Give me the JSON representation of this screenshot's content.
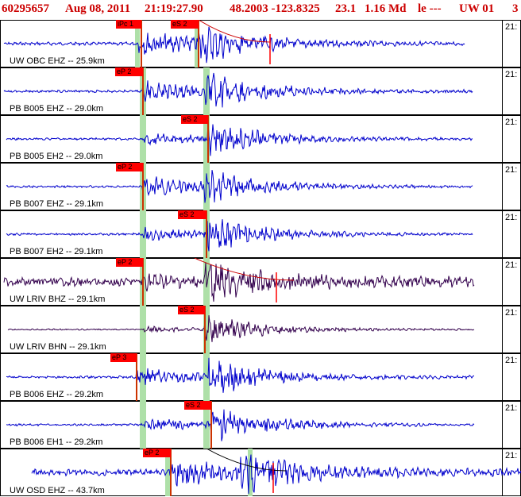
{
  "header": {
    "event_id": "60295657",
    "date": "Aug 08, 2011",
    "time": "21:19:27.90",
    "location": "48.2003 -123.8325",
    "depth": "23.1",
    "magnitude": "1.16 Md",
    "type": "le ---",
    "network": "UW 01",
    "extra": "3"
  },
  "colors": {
    "header_text": "#cc0000",
    "trace_blue": "#0000cc",
    "trace_dark": "#33004d",
    "pick_red": "#ff0000",
    "window_green": "#aee0a8",
    "coda_red": "#cc0000",
    "coda_black": "#000000"
  },
  "panels": [
    {
      "label": "UW OBC EHZ -- 25.9km",
      "time_label": "21:",
      "picks": [
        {
          "text": "iPc 1"
        },
        {
          "text": "eS 2"
        }
      ],
      "color": "blue",
      "coda": "red"
    },
    {
      "label": "PB B005 EHZ -- 29.0km",
      "time_label": "21:",
      "picks": [
        {
          "text": "eP 2"
        }
      ],
      "color": "blue",
      "coda": ""
    },
    {
      "label": "PB B005 EH2 -- 29.0km",
      "time_label": "21:",
      "picks": [
        {
          "text": "eS 2"
        }
      ],
      "color": "blue",
      "coda": ""
    },
    {
      "label": "PB B007 EHZ -- 29.1km",
      "time_label": "21:",
      "picks": [
        {
          "text": "eP 2"
        }
      ],
      "color": "blue",
      "coda": ""
    },
    {
      "label": "PB B007 EH2 -- 29.1km",
      "time_label": "21:",
      "picks": [
        {
          "text": "eS 2"
        }
      ],
      "color": "blue",
      "coda": ""
    },
    {
      "label": "UW LRIV BHZ -- 29.1km",
      "time_label": "21:",
      "picks": [
        {
          "text": "eP 2"
        }
      ],
      "color": "dark",
      "coda": "red"
    },
    {
      "label": "UW LRIV BHN -- 29.1km",
      "time_label": "21:",
      "picks": [
        {
          "text": "eS 2"
        }
      ],
      "color": "dark",
      "coda": ""
    },
    {
      "label": "PB B006 EHZ -- 29.2km",
      "time_label": "21:",
      "picks": [
        {
          "text": "eP 3"
        }
      ],
      "color": "blue",
      "coda": ""
    },
    {
      "label": "PB B006 EH1 -- 29.2km",
      "time_label": "21:",
      "picks": [
        {
          "text": "eS 2"
        }
      ],
      "color": "blue",
      "coda": ""
    },
    {
      "label": "UW OSD EHZ -- 43.7km",
      "time_label": "21:",
      "picks": [
        {
          "text": "eP 2"
        }
      ],
      "color": "blue",
      "coda": "black"
    }
  ]
}
